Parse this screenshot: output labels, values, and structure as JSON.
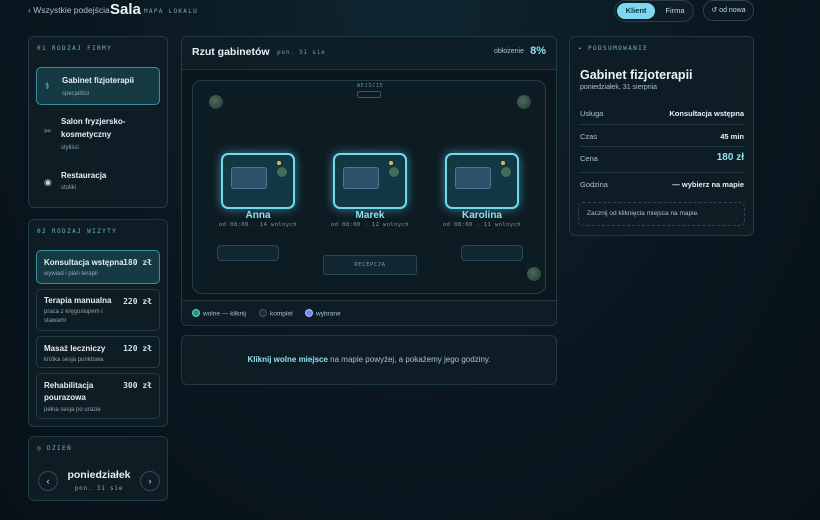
{
  "header": {
    "back_label": "‹ Wszystkie podejścia",
    "title": "Sala",
    "subtitle": "MAPA LOKALU",
    "toggle": {
      "option_a": "Klient",
      "option_b": "Firma",
      "selected": "Klient"
    },
    "reset_label": "↺ od nowa"
  },
  "business": {
    "section_label": "01 RODZAJ FIRMY",
    "items": [
      {
        "icon": "stethoscope-icon",
        "glyph": "⚕",
        "name": "Gabinet fizjoterapii",
        "sub": "specjaliści",
        "active": true
      },
      {
        "icon": "scissors-icon",
        "glyph": "✂",
        "name": "Salon fryzjersko-kosmetyczny",
        "sub": "styliści",
        "active": false
      },
      {
        "icon": "plate-icon",
        "glyph": "◉",
        "name": "Restauracja",
        "sub": "stoliki",
        "active": false
      }
    ]
  },
  "services": {
    "section_label": "02 RODZAJ WIZYTY",
    "items": [
      {
        "name": "Konsultacja wstępna",
        "desc": "wywiad i plan terapii",
        "price": "180 zł",
        "active": true
      },
      {
        "name": "Terapia manualna",
        "desc": "praca z kręgosłupem i stawami",
        "price": "220 zł",
        "active": false
      },
      {
        "name": "Masaż leczniczy",
        "desc": "krótka sesja punktowa",
        "price": "120 zł",
        "active": false
      },
      {
        "name": "Rehabilitacja pourazowa",
        "desc": "pełna sesja po urazie",
        "price": "300 zł",
        "active": false
      }
    ]
  },
  "day": {
    "section_label": "◷ DZIEŃ",
    "name": "poniedziałek",
    "date": "pon. 31 sie",
    "prev_glyph": "‹",
    "next_glyph": "›"
  },
  "map": {
    "title": "Rzut gabinetów",
    "date": "pon. 31 sie",
    "occupancy_label": "obłożenie",
    "occupancy_value": "8%",
    "entrance_label": "WEJŚCIE",
    "reception_label": "RECEPCJA",
    "stations": [
      {
        "name": "Anna",
        "info": "od 08:00 · 14 wolnych"
      },
      {
        "name": "Marek",
        "info": "od 08:00 · 12 wolnych"
      },
      {
        "name": "Karolina",
        "info": "od 08:00 · 11 wolnych"
      }
    ],
    "legend": {
      "free": "wolne — kliknij",
      "full": "komplet",
      "selected": "wybrane",
      "colors": {
        "free": "#2f8f86",
        "full": "#1d2c33",
        "selected": "#6d8cf0"
      }
    }
  },
  "hint": {
    "strong": "Kliknij wolne miejsce",
    "rest": " na mapie powyżej, a pokażemy jego godziny."
  },
  "summary": {
    "section_label": "✦ PODSUMOWANIE",
    "title": "Gabinet fizjoterapii",
    "subtitle": "poniedziałek, 31 sierpnia",
    "rows": [
      {
        "k": "Usługa",
        "v": "Konsultacja wstępna"
      },
      {
        "k": "Czas",
        "v": "45 min"
      },
      {
        "k": "Cena",
        "v": "180 zł"
      },
      {
        "k": "Godzina",
        "v": "— wybierz na mapie"
      }
    ],
    "hint": "Zacznij od kliknięcia miejsca na mapie."
  }
}
